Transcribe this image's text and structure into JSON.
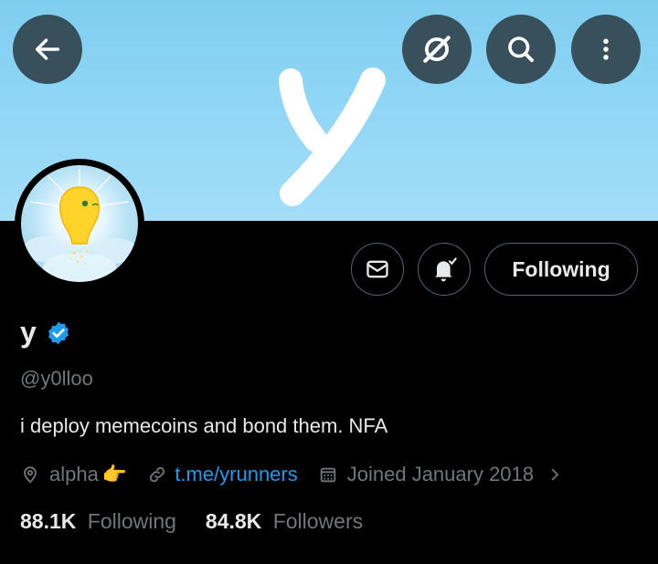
{
  "header": {
    "back_icon": "arrow-left-icon",
    "grok_icon": "grok-icon",
    "search_icon": "search-icon",
    "more_icon": "more-vertical-icon",
    "banner_glyph": "y"
  },
  "actions": {
    "message_icon": "envelope-icon",
    "notify_icon": "bell-check-icon",
    "following_label": "Following"
  },
  "profile": {
    "name": "y",
    "verified_icon": "verified-badge-icon",
    "handle": "@y0lloo",
    "bio": "i deploy memecoins and bond them. NFA",
    "location": "alpha",
    "location_emoji": "👉",
    "link": "t.me/yrunners",
    "joined": "Joined January 2018"
  },
  "stats": {
    "following_count": "88.1K",
    "following_label": "Following",
    "followers_count": "84.8K",
    "followers_label": "Followers"
  },
  "colors": {
    "accent": "#1d9bf0",
    "muted": "#71767b",
    "border": "#536471",
    "banner": "#8fd6f6"
  }
}
